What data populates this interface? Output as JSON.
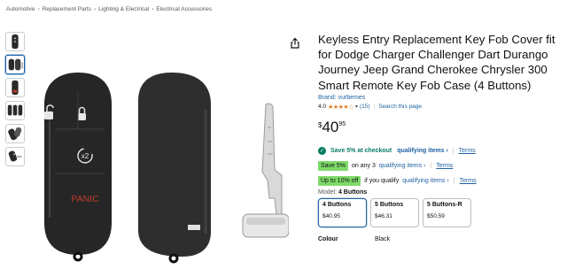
{
  "breadcrumb": [
    "Automotive",
    "Replacement Parts",
    "Lighting & Electrical",
    "Electrical Accessories"
  ],
  "breadcrumb_separator": "›",
  "product": {
    "title": "Keyless Entry Replacement Key Fob Cover fit for Dodge Charger Challenger Dart Durango Journey Jeep Grand Cherokee Chrysler 300 Smart Remote Key Fob Case (4 Buttons)",
    "brand": "Brand: vurbemes",
    "rating_value": "4.0",
    "stars": "★★★★☆",
    "rating_count": "(15)",
    "search_link": "Search this page",
    "price": {
      "symbol": "$",
      "whole": "40",
      "fraction": "95"
    }
  },
  "fob_image": {
    "panic_label": "PANIC",
    "x2_label": "x2"
  },
  "promos": {
    "checkout": {
      "text": "Save 5% at checkout",
      "link": "qualifying items ›",
      "terms": "Terms"
    },
    "save_any": {
      "badge": "Save 5%",
      "text": "on any 3",
      "link": "qualifying items ›",
      "terms": "Terms"
    },
    "upto": {
      "badge": "Up to 10% off",
      "text": "if you qualify",
      "link": "qualifying items ›",
      "terms": "Terms"
    }
  },
  "model": {
    "label": "Model:",
    "selected": "4 Buttons"
  },
  "variants": [
    {
      "name": "4 Buttons",
      "price": "$40.95",
      "selected": true
    },
    {
      "name": "5 Buttons",
      "price": "$46.31",
      "selected": false
    },
    {
      "name": "5 Buttons-R",
      "price": "$50.59",
      "selected": false
    }
  ],
  "colour": {
    "label": "Colour",
    "value": "Black"
  },
  "thumbnails": [
    "fob-front",
    "fob-side",
    "fob-panic",
    "fob-case-set",
    "fob-open",
    "fob-blade"
  ],
  "colors": {
    "link": "#2162a1",
    "deal_green": "#067d62",
    "badge_green": "#7fda69",
    "star": "#de7921",
    "panic_red": "#c03a2b"
  }
}
